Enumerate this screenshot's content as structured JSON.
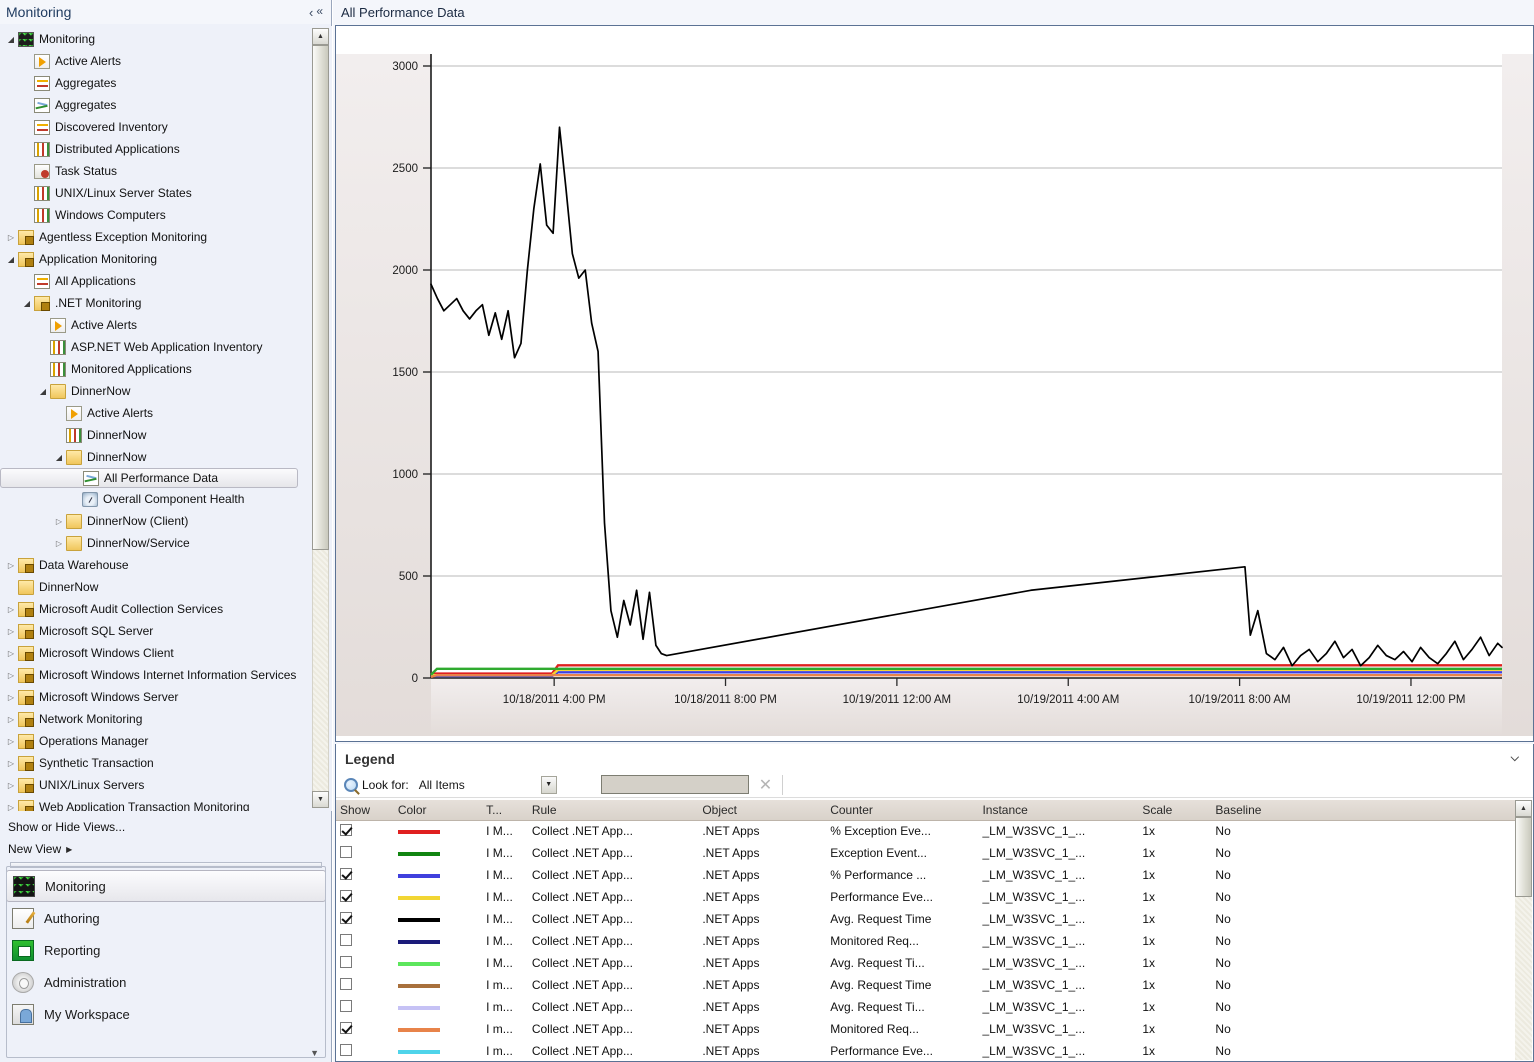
{
  "nav": {
    "header_title": "Monitoring",
    "collapse_icon": "«",
    "tree": [
      {
        "label": "Monitoring",
        "depth": 0,
        "twisty": "open",
        "icon": "monitor"
      },
      {
        "label": "Active Alerts",
        "depth": 1,
        "twisty": "none",
        "icon": "alert"
      },
      {
        "label": "Aggregates",
        "depth": 1,
        "twisty": "none",
        "icon": "inventory"
      },
      {
        "label": "Aggregates",
        "depth": 1,
        "twisty": "none",
        "icon": "chart"
      },
      {
        "label": "Discovered Inventory",
        "depth": 1,
        "twisty": "none",
        "icon": "inventory"
      },
      {
        "label": "Distributed Applications",
        "depth": 1,
        "twisty": "none",
        "icon": "grid"
      },
      {
        "label": "Task Status",
        "depth": 1,
        "twisty": "none",
        "icon": "task"
      },
      {
        "label": "UNIX/Linux Server States",
        "depth": 1,
        "twisty": "none",
        "icon": "grid"
      },
      {
        "label": "Windows Computers",
        "depth": 1,
        "twisty": "none",
        "icon": "grid"
      },
      {
        "label": "Agentless Exception Monitoring",
        "depth": 0,
        "twisty": "closed",
        "icon": "folder-lock"
      },
      {
        "label": "Application Monitoring",
        "depth": 0,
        "twisty": "open",
        "icon": "folder-lock"
      },
      {
        "label": "All Applications",
        "depth": 1,
        "twisty": "none",
        "icon": "inventory"
      },
      {
        "label": ".NET Monitoring",
        "depth": 1,
        "twisty": "open",
        "icon": "folder-lock"
      },
      {
        "label": "Active Alerts",
        "depth": 2,
        "twisty": "none",
        "icon": "alert"
      },
      {
        "label": "ASP.NET Web Application Inventory",
        "depth": 2,
        "twisty": "none",
        "icon": "grid"
      },
      {
        "label": "Monitored Applications",
        "depth": 2,
        "twisty": "none",
        "icon": "grid"
      },
      {
        "label": "DinnerNow",
        "depth": 2,
        "twisty": "open",
        "icon": "folder"
      },
      {
        "label": "Active Alerts",
        "depth": 3,
        "twisty": "none",
        "icon": "alert"
      },
      {
        "label": "DinnerNow",
        "depth": 3,
        "twisty": "none",
        "icon": "grid"
      },
      {
        "label": "DinnerNow",
        "depth": 3,
        "twisty": "open",
        "icon": "folder"
      },
      {
        "label": "All Performance Data",
        "depth": 4,
        "twisty": "none",
        "icon": "chart",
        "selected": true
      },
      {
        "label": "Overall Component Health",
        "depth": 4,
        "twisty": "none",
        "icon": "gauge"
      },
      {
        "label": "DinnerNow (Client)",
        "depth": 3,
        "twisty": "closed",
        "icon": "folder"
      },
      {
        "label": "DinnerNow/Service",
        "depth": 3,
        "twisty": "closed",
        "icon": "folder"
      },
      {
        "label": "Data Warehouse",
        "depth": 0,
        "twisty": "closed",
        "icon": "folder-lock"
      },
      {
        "label": "DinnerNow",
        "depth": 0,
        "twisty": "none",
        "icon": "folder"
      },
      {
        "label": "Microsoft Audit Collection Services",
        "depth": 0,
        "twisty": "closed",
        "icon": "folder-lock"
      },
      {
        "label": "Microsoft SQL Server",
        "depth": 0,
        "twisty": "closed",
        "icon": "folder-lock"
      },
      {
        "label": "Microsoft Windows Client",
        "depth": 0,
        "twisty": "closed",
        "icon": "folder-lock"
      },
      {
        "label": "Microsoft Windows Internet Information Services",
        "depth": 0,
        "twisty": "closed",
        "icon": "folder-lock"
      },
      {
        "label": "Microsoft Windows Server",
        "depth": 0,
        "twisty": "closed",
        "icon": "folder-lock"
      },
      {
        "label": "Network Monitoring",
        "depth": 0,
        "twisty": "closed",
        "icon": "folder-lock"
      },
      {
        "label": "Operations Manager",
        "depth": 0,
        "twisty": "closed",
        "icon": "folder-lock"
      },
      {
        "label": "Synthetic Transaction",
        "depth": 0,
        "twisty": "closed",
        "icon": "folder-lock"
      },
      {
        "label": "UNIX/Linux Servers",
        "depth": 0,
        "twisty": "closed",
        "icon": "folder-lock"
      },
      {
        "label": "Web Application Transaction Monitoring",
        "depth": 0,
        "twisty": "closed",
        "icon": "folder-lock"
      }
    ],
    "links": [
      {
        "label": "Show or Hide Views...",
        "arrow": ""
      },
      {
        "label": "New View",
        "arrow": "▶"
      }
    ],
    "workspaces": [
      {
        "label": "Monitoring",
        "icon": "monitoring-icon",
        "selected": true
      },
      {
        "label": "Authoring",
        "icon": "authoring-icon",
        "selected": false
      },
      {
        "label": "Reporting",
        "icon": "reporting-icon",
        "selected": false
      },
      {
        "label": "Administration",
        "icon": "administration-icon",
        "selected": false
      },
      {
        "label": "My Workspace",
        "icon": "my-workspace-icon",
        "selected": false
      }
    ],
    "more_icon": "▼"
  },
  "content": {
    "header_title": "All Performance Data",
    "collapse_icon": "‹"
  },
  "legend": {
    "title": "Legend",
    "collapse_icon": "⌵",
    "lookfor_label": "Look for:",
    "lookfor_value": "All Items",
    "lookfor_arrow": "▼",
    "search_value": "",
    "search_placeholder": "",
    "clear_icon": "✕",
    "columns": [
      "Show",
      "Color",
      "T...",
      "Rule",
      "Object",
      "Counter",
      "Instance",
      "Scale",
      "Baseline"
    ],
    "rows": [
      {
        "show": true,
        "color": "#e02020",
        "t": "I M...",
        "rule": "Collect .NET App...",
        "object": ".NET Apps",
        "counter": "% Exception Eve...",
        "instance": "_LM_W3SVC_1_...",
        "scale": "1x",
        "baseline": "No"
      },
      {
        "show": false,
        "color": "#118511",
        "t": "I M...",
        "rule": "Collect .NET App...",
        "object": ".NET Apps",
        "counter": "Exception Event...",
        "instance": "_LM_W3SVC_1_...",
        "scale": "1x",
        "baseline": "No"
      },
      {
        "show": true,
        "color": "#4040dd",
        "t": "I M...",
        "rule": "Collect .NET App...",
        "object": ".NET Apps",
        "counter": "% Performance ...",
        "instance": "_LM_W3SVC_1_...",
        "scale": "1x",
        "baseline": "No"
      },
      {
        "show": true,
        "color": "#f2d633",
        "t": "I M...",
        "rule": "Collect .NET App...",
        "object": ".NET Apps",
        "counter": "Performance Eve...",
        "instance": "_LM_W3SVC_1_...",
        "scale": "1x",
        "baseline": "No"
      },
      {
        "show": true,
        "color": "#000000",
        "t": "I M...",
        "rule": "Collect .NET App...",
        "object": ".NET Apps",
        "counter": "Avg. Request Time",
        "instance": "_LM_W3SVC_1_...",
        "scale": "1x",
        "baseline": "No"
      },
      {
        "show": false,
        "color": "#1b1b7a",
        "t": "I M...",
        "rule": "Collect .NET App...",
        "object": ".NET Apps",
        "counter": "Monitored Req...",
        "instance": "_LM_W3SVC_1_...",
        "scale": "1x",
        "baseline": "No"
      },
      {
        "show": false,
        "color": "#5ce65c",
        "t": "I M...",
        "rule": "Collect .NET App...",
        "object": ".NET Apps",
        "counter": "Avg. Request Ti...",
        "instance": "_LM_W3SVC_1_...",
        "scale": "1x",
        "baseline": "No"
      },
      {
        "show": false,
        "color": "#a8703c",
        "t": "I m...",
        "rule": "Collect .NET App...",
        "object": ".NET Apps",
        "counter": "Avg. Request Time",
        "instance": "_LM_W3SVC_1_...",
        "scale": "1x",
        "baseline": "No"
      },
      {
        "show": false,
        "color": "#c6c2f5",
        "t": "I m...",
        "rule": "Collect .NET App...",
        "object": ".NET Apps",
        "counter": "Avg. Request Ti...",
        "instance": "_LM_W3SVC_1_...",
        "scale": "1x",
        "baseline": "No"
      },
      {
        "show": true,
        "color": "#e8834a",
        "t": "I m...",
        "rule": "Collect .NET App...",
        "object": ".NET Apps",
        "counter": "Monitored Req...",
        "instance": "_LM_W3SVC_1_...",
        "scale": "1x",
        "baseline": "No"
      },
      {
        "show": false,
        "color": "#4fd4ea",
        "t": "I m...",
        "rule": "Collect .NET App...",
        "object": ".NET Apps",
        "counter": "Performance Eve...",
        "instance": "_LM_W3SVC_1_...",
        "scale": "1x",
        "baseline": "No"
      }
    ]
  },
  "chart_data": {
    "type": "line",
    "title": "",
    "xlabel": "",
    "ylabel": "",
    "ylim": [
      0,
      3000
    ],
    "yticks": [
      0,
      500,
      1000,
      1500,
      2000,
      2500,
      3000
    ],
    "ytick_labels": [
      "0",
      "500",
      "1000",
      "1500",
      "2000",
      "2500",
      "3000"
    ],
    "grid": true,
    "legend_position": "below-chart",
    "xtick_labels": [
      "10/18/2011 4:00 PM",
      "10/18/2011 8:00 PM",
      "10/19/2011 12:00 AM",
      "10/19/2011 4:00 AM",
      "10/19/2011 8:00 AM",
      "10/19/2011 12:00 PM"
    ],
    "xtick_positions": [
      0.115,
      0.275,
      0.435,
      0.595,
      0.755,
      0.915
    ],
    "series": [
      {
        "name": "Avg. Request Time",
        "color": "#000000",
        "x": [
          0.0,
          0.006,
          0.012,
          0.018,
          0.024,
          0.03,
          0.036,
          0.042,
          0.048,
          0.054,
          0.06,
          0.066,
          0.072,
          0.078,
          0.084,
          0.09,
          0.096,
          0.102,
          0.108,
          0.114,
          0.12,
          0.126,
          0.132,
          0.138,
          0.144,
          0.15,
          0.156,
          0.162,
          0.168,
          0.174,
          0.18,
          0.186,
          0.192,
          0.198,
          0.204,
          0.21,
          0.215,
          0.22,
          0.56,
          0.76,
          0.765,
          0.772,
          0.78,
          0.788,
          0.796,
          0.804,
          0.812,
          0.82,
          0.828,
          0.836,
          0.844,
          0.852,
          0.86,
          0.868,
          0.876,
          0.884,
          0.892,
          0.9,
          0.908,
          0.916,
          0.924,
          0.932,
          0.94,
          0.948,
          0.956,
          0.964,
          0.972,
          0.98,
          0.988,
          0.996,
          1.0
        ],
        "y": [
          1930,
          1860,
          1800,
          1830,
          1860,
          1800,
          1760,
          1800,
          1830,
          1680,
          1790,
          1660,
          1800,
          1570,
          1640,
          2000,
          2300,
          2520,
          2220,
          2180,
          2700,
          2400,
          2080,
          1960,
          2000,
          1740,
          1600,
          760,
          330,
          200,
          380,
          260,
          430,
          190,
          420,
          160,
          120,
          110,
          430,
          545,
          210,
          330,
          120,
          90,
          150,
          60,
          110,
          140,
          80,
          120,
          180,
          100,
          140,
          60,
          100,
          160,
          110,
          90,
          130,
          80,
          150,
          100,
          70,
          120,
          180,
          90,
          140,
          200,
          110,
          170,
          150
        ]
      },
      {
        "name": "% Exception Events",
        "color": "#e02020",
        "flat_y": 62,
        "start_x": 0.113
      },
      {
        "name": "% Performance Events",
        "color": "#4040dd",
        "flat_y": 28,
        "start_x": 0.113
      },
      {
        "name": "Performance Events",
        "color": "#f2d633",
        "flat_y": 40,
        "start_x": 0.113
      },
      {
        "name": "Monitored Requests",
        "color": "#e8834a",
        "flat_y": 14,
        "start_x": 0.0
      },
      {
        "name": "Exception Events (low)",
        "color": "#2faa2f",
        "flat_y": 45,
        "start_x": 0.0
      }
    ]
  }
}
